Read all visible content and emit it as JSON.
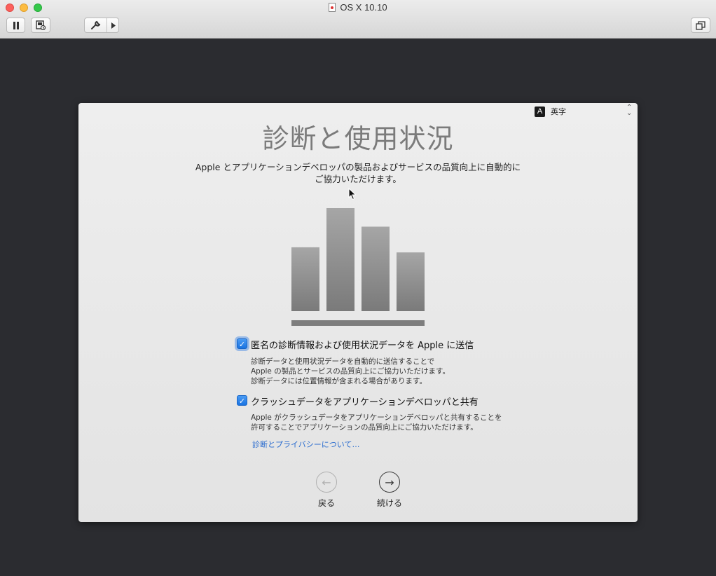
{
  "window": {
    "title": "OS X 10.10"
  },
  "toolbar": {
    "pause_icon": "pause-icon",
    "snapshot_icon": "snapshot-icon",
    "tools_icon": "wrench-icon",
    "window_icon": "window-restore-icon"
  },
  "panel": {
    "input_source": {
      "badge": "A",
      "label": "英字"
    },
    "title": "診断と使用状況",
    "description_line1": "Apple とアプリケーションデベロッパの製品およびサービスの品質向上に自動的に",
    "description_line2": "ご協力いただけます。",
    "chart": {
      "icon": "bar-chart-icon",
      "values": [
        0.62,
        1.0,
        0.82,
        0.57
      ]
    },
    "option1": {
      "checked": true,
      "label": "匿名の診断情報および使用状況データを Apple に送信",
      "desc_line1": "診断データと使用状況データを自動的に送信することで",
      "desc_line2": "Apple の製品とサービスの品質向上にご協力いただけます。",
      "desc_line3": "診断データには位置情報が含まれる場合があります。"
    },
    "option2": {
      "checked": true,
      "label": "クラッシュデータをアプリケーションデベロッパと共有",
      "desc_line1": "Apple がクラッシュデータをアプリケーションデベロッパと共有することを",
      "desc_line2": "許可することでアプリケーションの品質向上にご協力いただけます。"
    },
    "privacy_link": "診断とプライバシーについて…",
    "back": {
      "label": "戻る",
      "icon": "arrow-left-circle-icon"
    },
    "next": {
      "label": "続ける",
      "icon": "arrow-right-circle-icon"
    }
  },
  "colors": {
    "accent": "#1a73e2",
    "link": "#2a6ccf",
    "desktop": "#2b2c30"
  }
}
